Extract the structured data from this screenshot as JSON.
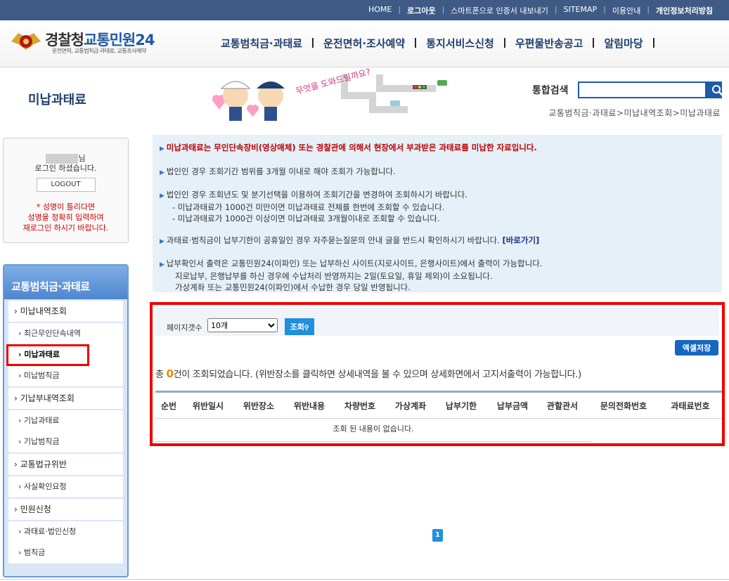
{
  "topnav": {
    "home": "HOME",
    "logout": "로그아웃",
    "export_cert": "스마트폰으로 인증서 내보내기",
    "sitemap": "SITEMAP",
    "guide": "이용안내",
    "privacy": "개인정보처리방침"
  },
  "logo": {
    "title_prefix": "경찰청",
    "title_main": "교통민원24",
    "subtitle": "운전면허, 교통범칙금·과태료, 교통조사예약"
  },
  "gnb": [
    "교통범칙금·과태료",
    "운전면허·조사예약",
    "통지서비스신청",
    "우편물반송공고",
    "알림마당"
  ],
  "page": {
    "title": "미납과태료",
    "banner_text": "무엇을 도와드릴까요?",
    "search_label": "통합검색",
    "search_value": "",
    "breadcrumb": "교통범칙금·과태료>미납내역조회>미납과태료"
  },
  "login": {
    "suffix": "님",
    "status": "로그인 하셨습니다.",
    "logout_button": "LOGOUT",
    "warning": [
      "* 성명이 틀리다면",
      "성명을 정확히 입력하여",
      "재로그인 하시기 바랍니다."
    ]
  },
  "lnb": {
    "title": "교통범칙금·과태료",
    "sections": [
      {
        "label": "미납내역조회",
        "items": [
          "최근무인단속내역",
          "미납과태료",
          "미납범칙금"
        ]
      },
      {
        "label": "기납부내역조회",
        "items": [
          "기납과태료",
          "기납범칙금"
        ]
      },
      {
        "label": "교통법규위반",
        "items": [
          "사실확인요청"
        ]
      },
      {
        "label": "민원신청",
        "items": [
          "과태료·법인신청",
          "범칙금"
        ]
      }
    ]
  },
  "notice": {
    "n1": "미납과태료는 무인단속장비(영상매체) 또는 경찰관에 의해서 현장에서 부과받은 과태료를 미납한 자료입니다.",
    "n2": "법인인 경우 조회기간 범위를 3개월 이내로 해야 조회가 가능합니다.",
    "n3": "법인인 경우 조회년도 및 분기선택을 이용하여 조회기간을 변경하여 조회하시기 바랍니다.",
    "n3a": "- 미납과태료가 1000건 미만이면 미납과태료 전체를 한번에 조회할 수 있습니다.",
    "n3b": "- 미납과태료가 1000건 이상이면 미납과태료 3개월이내로 조회할 수 있습니다.",
    "n4": "과태료·범칙금이 납부기한이 공휴일인 경우 자주묻는질문의 안내 글을 반드시 확인하시기 바랍니다.",
    "n4_link": "[바로가기]",
    "n5": "납부확인서 출력은 교통민원24(이파인) 또는 납부하신 사이트(지로사이트, 은행사이트)에서 출력이 가능합니다.",
    "n5a": "지로납부, 은행납부를 하신 경우에 수납처리 반영까지는 2일(토요일, 휴일 제외)이 소요됩니다.",
    "n5b": "가상계좌 또는 교통민원24(이파인)에서 수납한 경우 당일 반영됩니다."
  },
  "result": {
    "page_size_label": "페이지갯수",
    "page_size_value": "10개",
    "query_button": "조회",
    "excel_button": "엑셀저장",
    "count_prefix": "총 ",
    "count": "0",
    "count_suffix": "건이 조회되었습니다. (위반장소를 클릭하면 상세내역을 볼 수 있으며 상세화면에서 고지서출력이 가능합니다.)",
    "columns": [
      "순번",
      "위반일시",
      "위반장소",
      "위반내용",
      "차량번호",
      "가상계좌",
      "납부기한",
      "납부금액",
      "관할관서",
      "문의전화번호",
      "과태료번호"
    ],
    "empty_message": "조회 된 내용이 없습니다."
  },
  "pagination": {
    "current": "1"
  }
}
